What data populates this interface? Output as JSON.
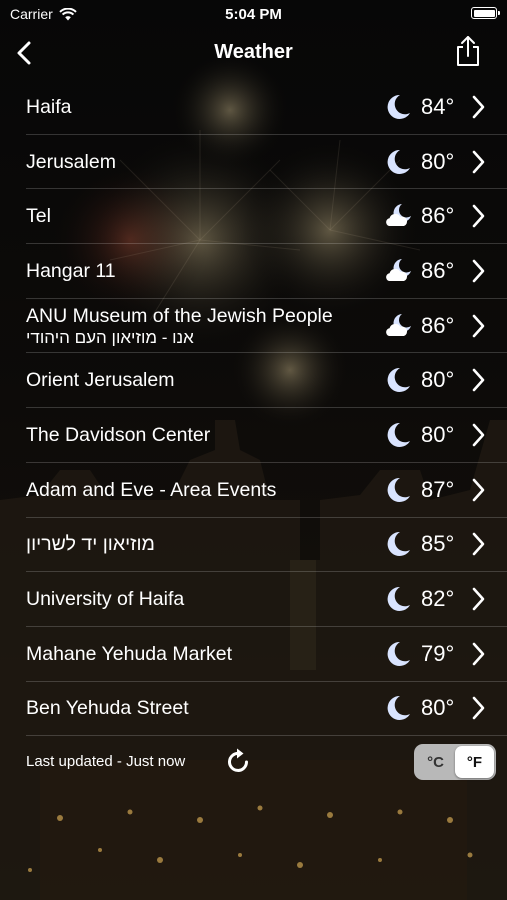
{
  "status_bar": {
    "carrier": "Carrier",
    "time": "5:04 PM"
  },
  "nav": {
    "title": "Weather",
    "back_icon": "chevron-left-icon",
    "share_icon": "share-icon"
  },
  "locations": [
    {
      "name": "Haifa",
      "subname": "",
      "icon": "moon",
      "temp": "84°"
    },
    {
      "name": "Jerusalem",
      "subname": "",
      "icon": "moon",
      "temp": "80°"
    },
    {
      "name": "Tel",
      "subname": "",
      "icon": "cloud-moon",
      "temp": "86°"
    },
    {
      "name": "Hangar 11",
      "subname": "",
      "icon": "cloud-moon",
      "temp": "86°"
    },
    {
      "name": "ANU Museum of the Jewish People",
      "subname": "אנו - מוזיאון העם היהודי",
      "icon": "cloud-moon",
      "temp": "86°"
    },
    {
      "name": "Orient Jerusalem",
      "subname": "",
      "icon": "moon",
      "temp": "80°"
    },
    {
      "name": "The Davidson Center",
      "subname": "",
      "icon": "moon",
      "temp": "80°"
    },
    {
      "name": "Adam and Eve - Area Events",
      "subname": "",
      "icon": "moon",
      "temp": "87°"
    },
    {
      "name": "מוזיאון יד לשריון",
      "subname": "",
      "icon": "moon",
      "temp": "85°"
    },
    {
      "name": "University of Haifa",
      "subname": "",
      "icon": "moon",
      "temp": "82°"
    },
    {
      "name": "Mahane Yehuda Market",
      "subname": "",
      "icon": "moon",
      "temp": "79°"
    },
    {
      "name": "Ben Yehuda Street",
      "subname": "",
      "icon": "moon",
      "temp": "80°"
    }
  ],
  "footer": {
    "last_updated": "Last updated - Just now",
    "refresh_icon": "refresh-icon",
    "unit_celsius": "°C",
    "unit_fahrenheit": "°F",
    "selected_unit": "°F"
  },
  "colors": {
    "moon": "#d9e4ff",
    "cloud": "#ffffff",
    "toggle_bg": "#b8b8b8"
  }
}
